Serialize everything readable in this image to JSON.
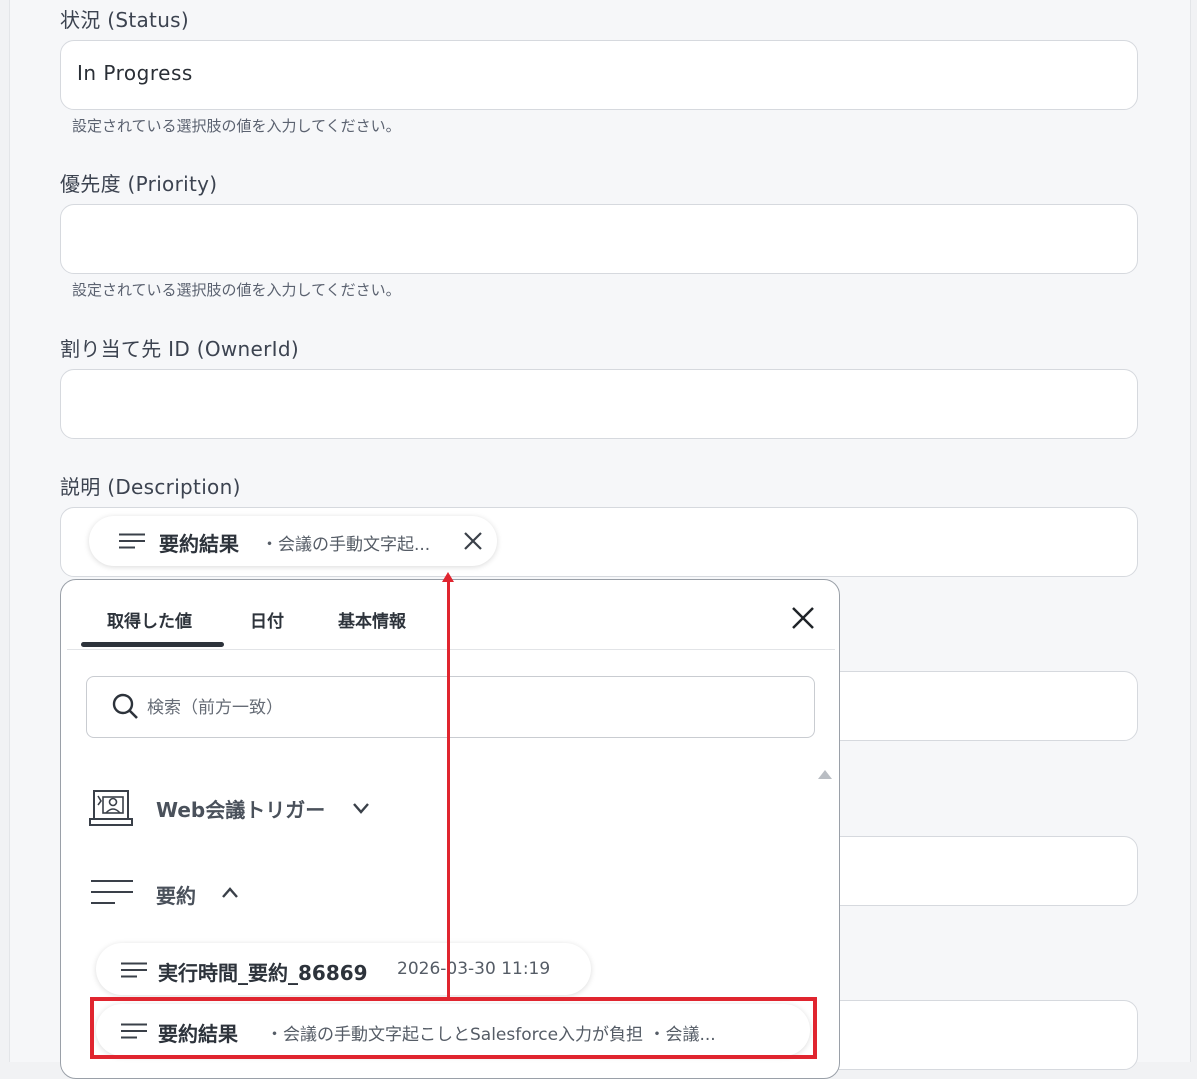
{
  "fields": [
    {
      "label": "状況 (Status)",
      "value": "In Progress",
      "hint": "設定されている選択肢の値を入力してください。"
    },
    {
      "label": "優先度 (Priority)",
      "value": "",
      "hint": "設定されている選択肢の値を入力してください。"
    },
    {
      "label": "割り当て先 ID (OwnerId)",
      "value": ""
    },
    {
      "label": "説明 (Description)"
    }
  ],
  "description_token": {
    "name": "要約結果",
    "preview": "・会議の手動文字起...",
    "remove_icon": "close-icon"
  },
  "picker": {
    "tabs": [
      "取得した値",
      "日付",
      "基本情報"
    ],
    "active_tab": 0,
    "close_icon": "close-icon",
    "search_placeholder": "検索（前方一致）",
    "search_icon": "search-icon",
    "groups": [
      {
        "title": "Web会議トリガー",
        "icon": "web-meeting-icon",
        "expanded": false
      },
      {
        "title": "要約",
        "icon": "text-lines-icon",
        "expanded": true,
        "items": [
          {
            "name": "実行時間_要約_86869",
            "preview": "2026-03-30 11:19"
          },
          {
            "name": "要約結果",
            "preview": "・会議の手動文字起こしとSalesforce入力が負担 ・会議..."
          }
        ]
      }
    ]
  },
  "colors": {
    "highlight": "#e0252f",
    "accent": "#2d333b"
  }
}
